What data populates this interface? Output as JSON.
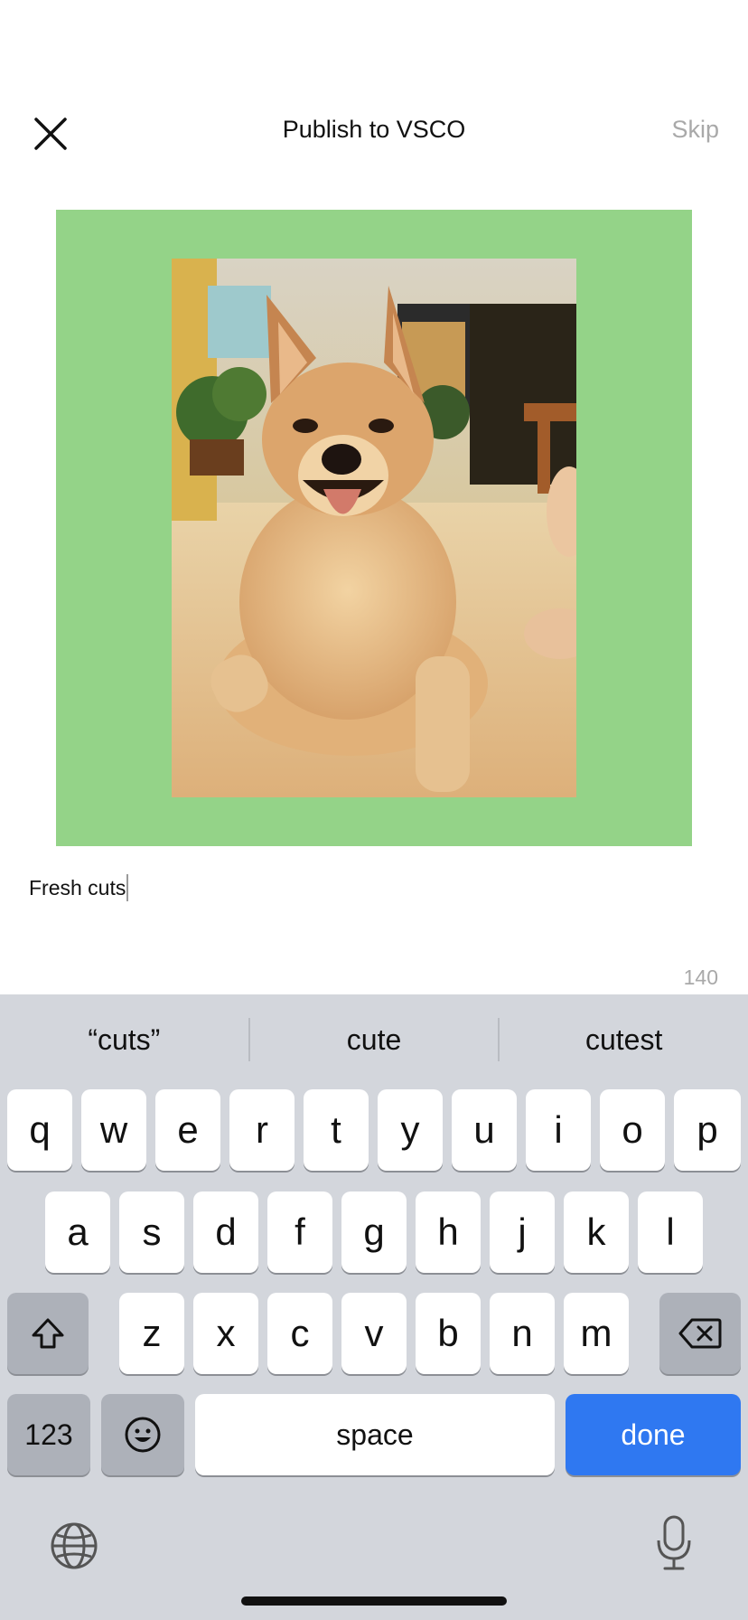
{
  "header": {
    "title": "Publish to VSCO",
    "skip_label": "Skip",
    "close_icon": "close-icon"
  },
  "photo": {
    "frame_color": "#94d388",
    "subject": "dog-photo"
  },
  "caption": {
    "value": "Fresh cuts",
    "char_count": "140"
  },
  "keyboard": {
    "suggestions": [
      "“cuts”",
      "cute",
      "cutest"
    ],
    "row1": [
      "q",
      "w",
      "e",
      "r",
      "t",
      "y",
      "u",
      "i",
      "o",
      "p"
    ],
    "row2": [
      "a",
      "s",
      "d",
      "f",
      "g",
      "h",
      "j",
      "k",
      "l"
    ],
    "row3": [
      "z",
      "x",
      "c",
      "v",
      "b",
      "n",
      "m"
    ],
    "numbers_label": "123",
    "space_label": "space",
    "done_label": "done",
    "done_color": "#2f78f1",
    "shift_icon": "shift-icon",
    "delete_icon": "backspace-icon",
    "emoji_icon": "emoji-icon",
    "globe_icon": "globe-icon",
    "mic_icon": "microphone-icon"
  }
}
